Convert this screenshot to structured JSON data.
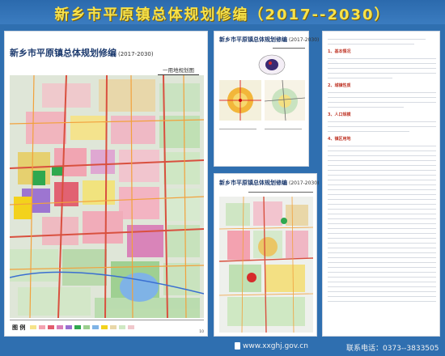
{
  "banner": {
    "title": "新乡市平原镇总体规划修编（2017--2030）"
  },
  "left_panel": {
    "title": "新乡市平原镇总体规划修编",
    "years": "(2017-2030)",
    "subtitle": "一用地规划图",
    "legend_label": "图 例",
    "page_no": "10"
  },
  "mid_top_panel": {
    "title": "新乡市平原镇总体规划修编",
    "years": "(2017-2030)"
  },
  "mid_bottom_panel": {
    "title": "新乡市平原镇总体规划修编",
    "years": "(2017-2030)"
  },
  "right_panel": {
    "headings": [
      "1、基本情况",
      "2、城镇性质",
      "3、人口规模",
      "4、镇区用地"
    ]
  },
  "footer": {
    "url": "www.xxghj.gov.cn",
    "hotline": "联系电话：0373--3833505"
  },
  "colors": {
    "background": "#2f6fb0",
    "title_yellow": "#f7e24a",
    "panel_title": "#1c3a6e"
  },
  "icons": [
    "water-blob-icon",
    "phone-logo-icon"
  ]
}
